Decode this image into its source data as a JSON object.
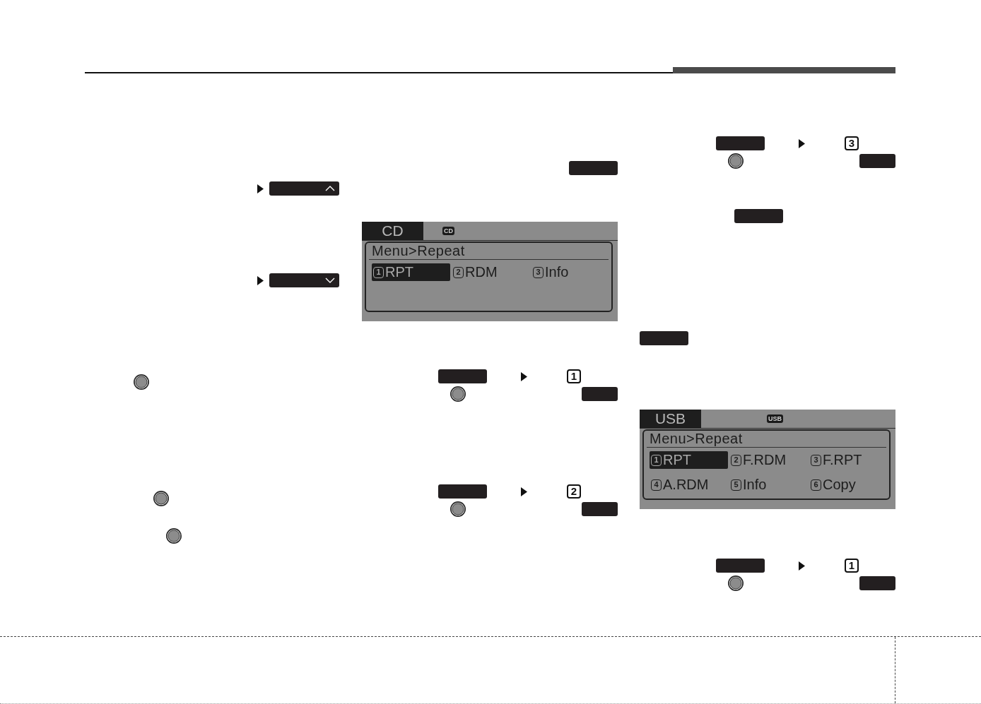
{
  "middle_column": {
    "screen": {
      "source": "CD",
      "badge": "CD",
      "title": "Menu>Repeat",
      "options": [
        {
          "number": "1",
          "label": "RPT",
          "selected": true
        },
        {
          "number": "2",
          "label": "RDM",
          "selected": false
        },
        {
          "number": "3",
          "label": "Info",
          "selected": false
        }
      ]
    },
    "steps": [
      {
        "number": "1"
      },
      {
        "number": "2"
      }
    ]
  },
  "right_column": {
    "top_step": {
      "number": "3"
    },
    "screen": {
      "source": "USB",
      "badge": "USB",
      "title": "Menu>Repeat",
      "options": [
        {
          "number": "1",
          "label": "RPT",
          "selected": true
        },
        {
          "number": "2",
          "label": "F.RDM",
          "selected": false
        },
        {
          "number": "3",
          "label": "F.RPT",
          "selected": false
        },
        {
          "number": "4",
          "label": "A.RDM",
          "selected": false
        },
        {
          "number": "5",
          "label": "Info",
          "selected": false
        },
        {
          "number": "6",
          "label": "Copy",
          "selected": false
        }
      ]
    },
    "bottom_step": {
      "number": "1"
    }
  }
}
